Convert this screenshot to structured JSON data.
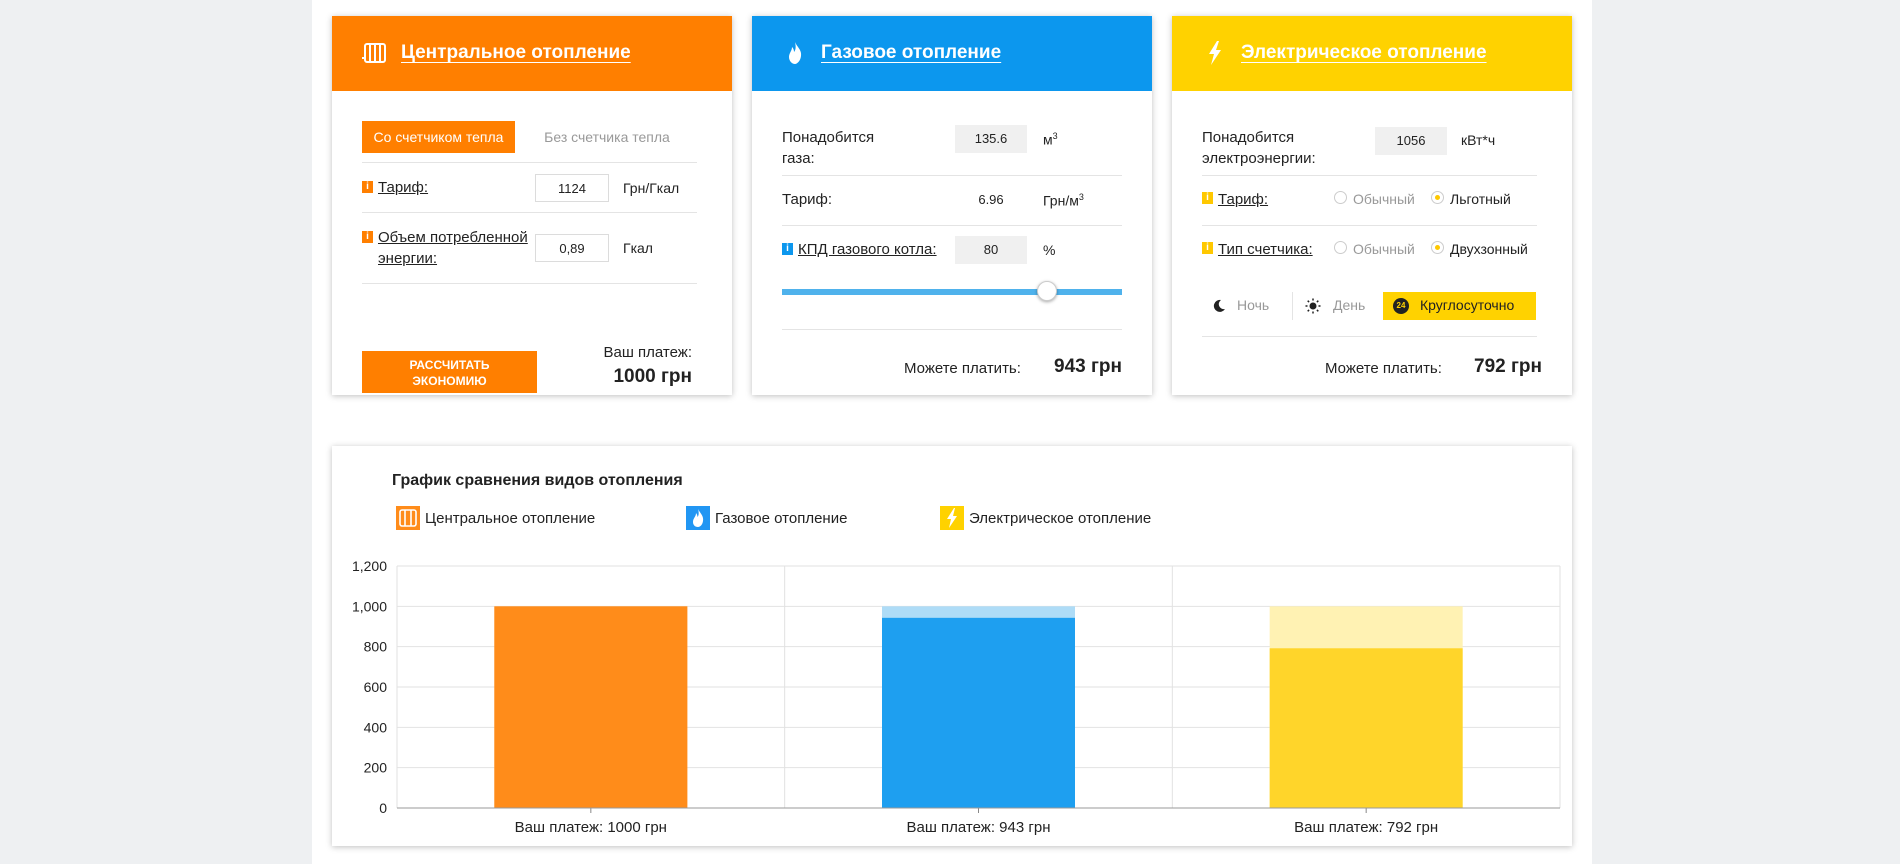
{
  "central": {
    "title": "Центральное отопление",
    "icon": "radiator-icon",
    "color": "#ff7f00",
    "tab_active": "Со счетчиком тепла",
    "tab_inactive": "Без счетчика тепла",
    "tariff_label": "Тариф:",
    "tariff_value": "1124",
    "tariff_unit": "Грн/Гкал",
    "volume_label_1": "Объем потребленной",
    "volume_label_2": "энергии:",
    "volume_value": "0,89",
    "volume_unit": "Гкал",
    "calc_button_1": "РАССЧИТАТЬ",
    "calc_button_2": "ЭКОНОМИЮ",
    "payment_label": "Ваш платеж:",
    "payment_value": "1000 грн"
  },
  "gas": {
    "title": "Газовое отопление",
    "icon": "flame-icon",
    "color": "#0c97ee",
    "need_label_1": "Понадобится",
    "need_label_2": "газа:",
    "need_value": "135.6",
    "need_unit": "м",
    "need_unit_sup": "3",
    "tariff_label": "Тариф:",
    "tariff_value": "6.96",
    "tariff_unit": "Грн/м",
    "tariff_unit_sup": "3",
    "kpd_label": "КПД газового котла:",
    "kpd_value": "80",
    "kpd_unit": "%",
    "slider_fraction": 0.8,
    "can_pay_label": "Можете платить:",
    "can_pay_value": "943 грн"
  },
  "electric": {
    "title": "Электрическое отопление",
    "icon": "lightning-icon",
    "color": "#ffd200",
    "need_label_1": "Понадобится",
    "need_label_2": "электроэнергии:",
    "need_value": "1056",
    "need_unit": "кВт*ч",
    "tariff_label": "Тариф:",
    "tariff_opt_1": "Обычный",
    "tariff_opt_2": "Льготный",
    "meter_label": "Тип счетчика:",
    "meter_opt_1": "Обычный",
    "meter_opt_2": "Двухзонный",
    "zone_night": "Ночь",
    "zone_day": "День",
    "zone_24_badge": "24",
    "zone_24": "Круглосуточно",
    "can_pay_label": "Можете платить:",
    "can_pay_value": "792 грн"
  },
  "chart_title": "График сравнения видов отопления",
  "legend": [
    {
      "label": "Центральное отопление",
      "icon": "radiator-icon",
      "color": "#ff8c1a"
    },
    {
      "label": "Газовое отопление",
      "icon": "flame-icon",
      "color": "#2196f3"
    },
    {
      "label": "Электрическое отопление",
      "icon": "lightning-icon",
      "color": "#ffd200"
    }
  ],
  "chart_data": {
    "type": "bar",
    "categories": [
      "Ваш платеж: 1000 грн",
      "Ваш платеж: 943 грн",
      "Ваш платеж: 792 грн"
    ],
    "series": [
      {
        "name": "Центральное отопление",
        "values": [
          1000,
          943,
          792
        ]
      }
    ],
    "background_values": [
      1000,
      1000,
      1000
    ],
    "bar_colors": [
      "#ff8c1a",
      "#1e9ff0",
      "#ffd52a"
    ],
    "bar_light_colors": [
      "#ffc48c",
      "#aedcf7",
      "#fff2b3"
    ],
    "ylim": [
      0,
      1200
    ],
    "yticks": [
      0,
      200,
      400,
      600,
      800,
      1000,
      1200
    ],
    "ytick_labels": [
      "0",
      "200",
      "400",
      "600",
      "800",
      "1,000",
      "1,200"
    ],
    "grid": true
  }
}
